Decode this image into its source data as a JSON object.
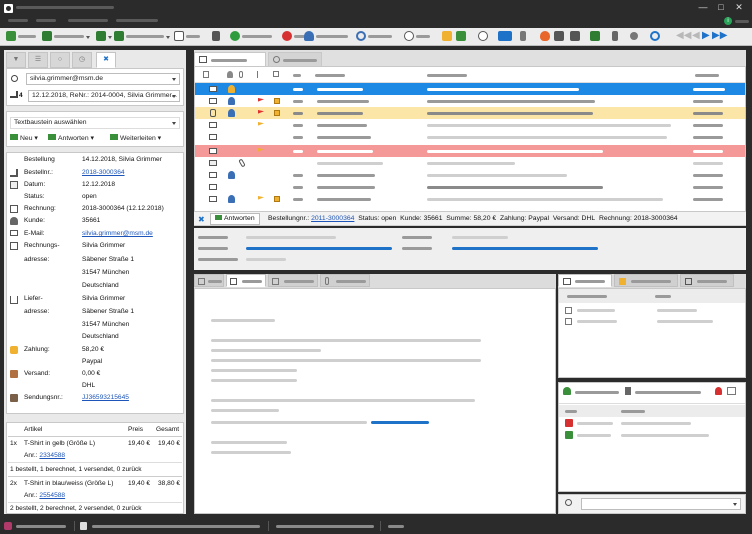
{
  "colors": {
    "accent": "#1e72c8",
    "selected_row": "#1e88e5",
    "highlight_yellow": "#fbe6a8",
    "highlight_red": "#f49898",
    "flag_red": "#e03030",
    "flag_yellow": "#f0b030",
    "link": "#1d55b8"
  },
  "left": {
    "search_value": "silvia.grimmer@msm.de",
    "order_count": "4",
    "order_select": "12.12.2018, ReNr.: 2014-0004, Silvia Grimmer...",
    "textbaustein": "Textbaustein auswählen",
    "actions": {
      "new": "Neu",
      "reply": "Antworten",
      "forward": "Weiterleiten"
    },
    "details": {
      "title_label": "Bestellung",
      "title_value": "14.12.2018, Silvia Grimmer",
      "bestellnr_label": "Bestellnr.:",
      "bestellnr_value": "2018-3000364",
      "datum_label": "Datum:",
      "datum_value": "12.12.2018",
      "status_label": "Status:",
      "status_value": "open",
      "rechnung_label": "Rechnung:",
      "rechnung_value": "2018-3000364 (12.12.2018)",
      "kunde_label": "Kunde:",
      "kunde_value": "35661",
      "email_label": "E-Mail:",
      "email_value": "silvia.grimmer@msm.de",
      "rech_adresse_label1": "Rechnungs-",
      "rech_adresse_label2": "adresse:",
      "rech_adresse": [
        "Silvia Grimmer",
        "Säbener Straße 1",
        "31547 München",
        "Deutschland"
      ],
      "lief_adresse_label1": "Liefer-",
      "lief_adresse_label2": "adresse:",
      "lief_adresse": [
        "Silvia Grimmer",
        "Säbener Straße 1",
        "31547 München",
        "Deutschland"
      ],
      "zahlung_label": "Zahlung:",
      "zahlung_value": "58,20 €",
      "zahlung_method": "Paypal",
      "versand_label": "Versand:",
      "versand_value": "0,00 €",
      "versand_method": "DHL",
      "sendung_label": "Sendungsnr.:",
      "sendung_value": "JJ36593215645"
    },
    "articles": {
      "headers": {
        "article": "Artikel",
        "price": "Preis",
        "total": "Gesamt"
      },
      "items": [
        {
          "qty": "1x",
          "name": "T-Shirt in gelb (Größe L)",
          "price": "19,40 €",
          "total": "19,40 €",
          "anr_label": "Anr.:",
          "anr": "2334588",
          "status": "1 bestellt, 1 berechnet, 1 versendet, 0 zurück"
        },
        {
          "qty": "2x",
          "name": "T-Shirt in blau/weiss (Größe L)",
          "price": "19,40 €",
          "total": "38,80 €",
          "anr_label": "Anr.:",
          "anr": "2554588",
          "status": "2 bestellt, 2 berechnet, 2 versendet, 0 zurück"
        }
      ]
    }
  },
  "statusline": {
    "reply": "Antworten",
    "bestellnr_label": "Bestellungnr.:",
    "bestellnr": "2011-3000364",
    "status": "Status: open",
    "kunde": "Kunde: 35661",
    "summe": "Summe: 58,20 €",
    "zahlung": "Zahlung: Paypal",
    "versand": "Versand: DHL",
    "rechnung": "Rechnung: 2018-3000364"
  },
  "icons": {
    "app": "app-icon",
    "minimize": "minimize-icon",
    "maximize": "maximize-icon",
    "close": "close-icon",
    "search": "search-icon",
    "cart": "cart-icon",
    "mail": "mail-icon",
    "flag": "flag-icon",
    "note": "note-icon",
    "person": "person-icon",
    "paperclip": "paperclip-icon",
    "printer": "printer-icon",
    "phone": "phone-icon"
  }
}
